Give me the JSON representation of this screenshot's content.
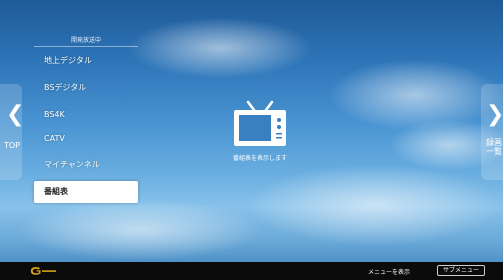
{
  "menu": {
    "header": "開発放送中",
    "items": [
      {
        "label": "地上デジタル"
      },
      {
        "label": "BSデジタル"
      },
      {
        "label": "BS4K"
      },
      {
        "label": "CATV"
      },
      {
        "label": "マイチャンネル"
      },
      {
        "label": "番組表",
        "selected": true
      }
    ]
  },
  "nav": {
    "left_label": "TOP",
    "right_label": "録画一覧"
  },
  "center": {
    "icon": "tv-icon",
    "caption": "番組表を表示します"
  },
  "bottom_bar": {
    "logo_text": "G",
    "menu_hint": "メニューを表示",
    "sub_menu_label": "サブメニュー"
  },
  "colors": {
    "sky_top": "#1f5a98",
    "sky_mid": "#6aaee0",
    "selected_bg": "#ffffff",
    "bar_bg": "#0b0b0b",
    "logo": "#d4a017"
  }
}
